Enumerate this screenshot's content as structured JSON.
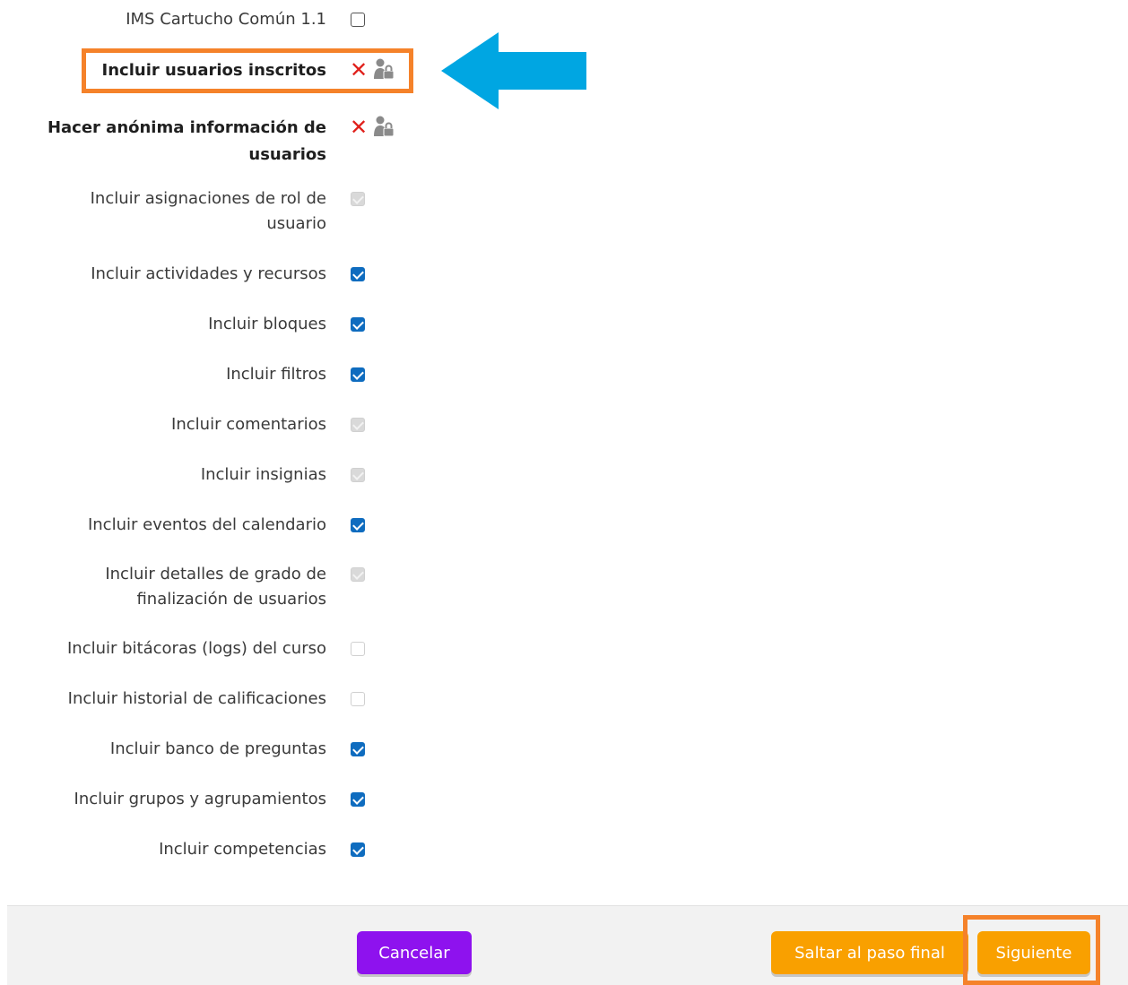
{
  "settings": {
    "ims_cartridge": {
      "label": "IMS Cartucho Común 1.1",
      "state": "unchecked"
    },
    "include_users": {
      "label": "Incluir usuarios inscritos",
      "state": "locked-no"
    },
    "anonymize_users": {
      "label_line1": "Hacer anónima información de",
      "label_line2": "usuarios",
      "state": "locked-no"
    },
    "role_assignments": {
      "label_line1": "Incluir asignaciones de rol de",
      "label_line2": "usuario",
      "state": "disabled-checked"
    },
    "activities": {
      "label": "Incluir actividades y recursos",
      "state": "checked"
    },
    "blocks": {
      "label": "Incluir bloques",
      "state": "checked"
    },
    "filters": {
      "label": "Incluir filtros",
      "state": "checked"
    },
    "comments": {
      "label": "Incluir comentarios",
      "state": "disabled-checked"
    },
    "badges": {
      "label": "Incluir insignias",
      "state": "disabled-checked"
    },
    "calendar": {
      "label": "Incluir eventos del calendario",
      "state": "checked"
    },
    "completion": {
      "label_line1": "Incluir detalles de grado de",
      "label_line2": "finalización de usuarios",
      "state": "disabled-checked"
    },
    "logs": {
      "label": "Incluir bitácoras (logs) del curso",
      "state": "disabled-unchecked"
    },
    "grade_history": {
      "label": "Incluir historial de calificaciones",
      "state": "disabled-unchecked"
    },
    "question_bank": {
      "label": "Incluir banco de preguntas",
      "state": "checked"
    },
    "groups": {
      "label": "Incluir grupos y agrupamientos",
      "state": "checked"
    },
    "competencies": {
      "label": "Incluir competencias",
      "state": "checked"
    }
  },
  "icons": {
    "no_mark": "x-mark-icon",
    "lock": "user-lock-icon"
  },
  "footer": {
    "cancel_label": "Cancelar",
    "skip_label": "Saltar al paso final",
    "next_label": "Siguiente"
  },
  "colors": {
    "checked": "#0f6cbf",
    "cancel_button": "#8e12ee",
    "primary_button": "#f9a000",
    "highlight": "#f5822a",
    "arrow": "#00a6e2",
    "x_mark": "#e0201b"
  }
}
